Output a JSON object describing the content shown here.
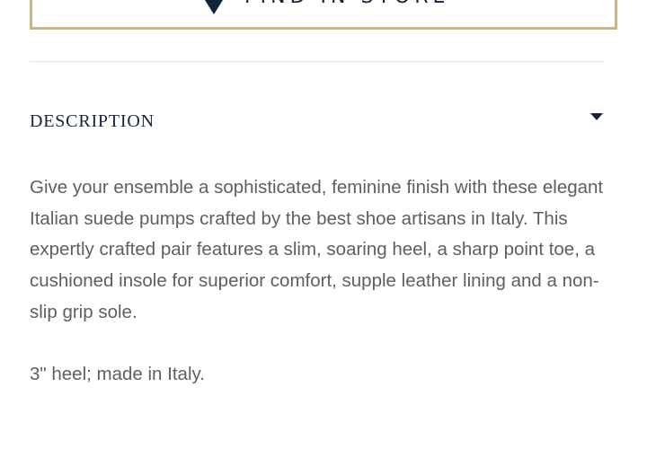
{
  "store_button": {
    "label": "FIND IN STORE",
    "icon": "map-pin-icon"
  },
  "description": {
    "title": "DESCRIPTION",
    "toggle_icon": "caret-down-icon",
    "body": "Give your ensemble a sophisticated, feminine finish with these elegant Italian suede pumps crafted by the best shoe artisans in Italy. This expertly crafted pair features a slim, soaring heel, a sharp point toe, a cushioned insole for superior comfort, supple leather lining and a non-slip grip sole.",
    "details": "3\" heel; made in Italy."
  },
  "colors": {
    "navy": "#14243b",
    "gold_border": "#c9b688",
    "body_text": "#5f5f5f",
    "divider": "#e4e4e4"
  }
}
